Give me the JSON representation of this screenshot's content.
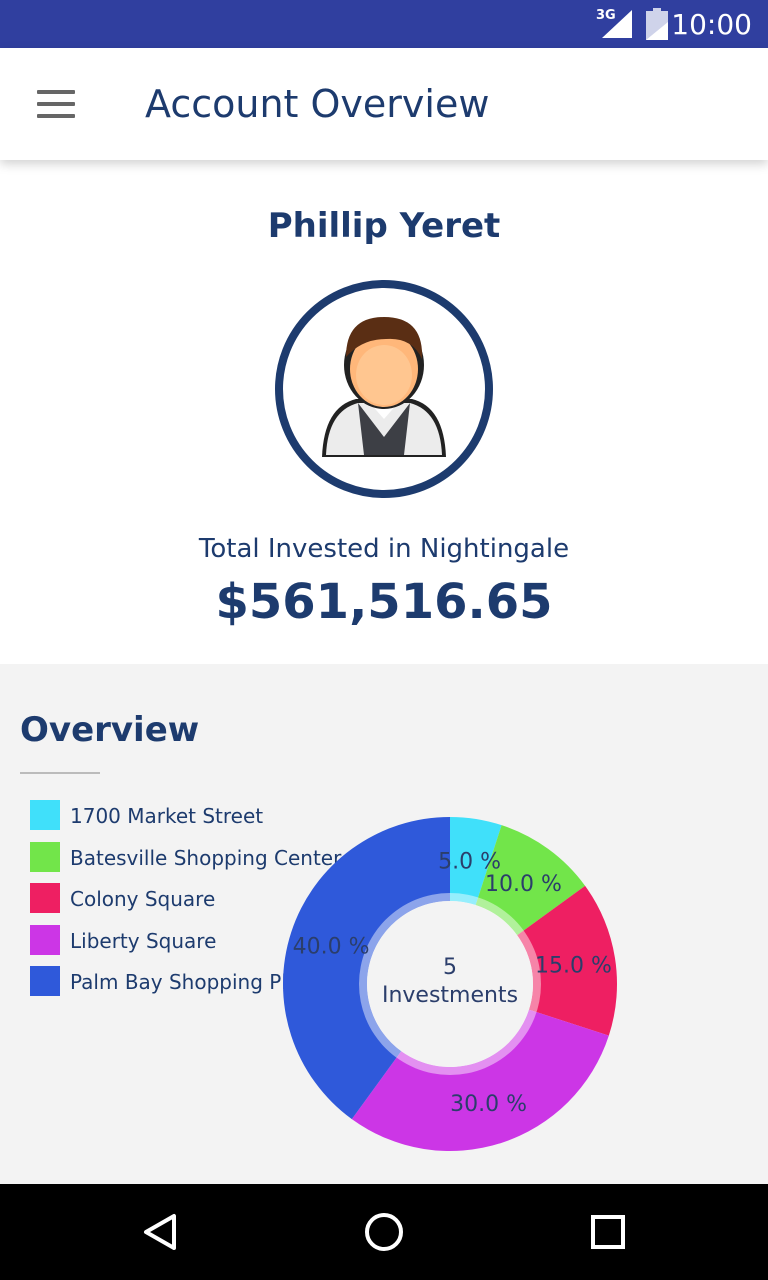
{
  "status_bar": {
    "network": "3G",
    "time": "10:00"
  },
  "app_bar": {
    "title": "Account Overview",
    "menu_icon": "hamburger-menu-icon"
  },
  "profile": {
    "name": "Phillip Yeret",
    "avatar_icon": "user-avatar-icon",
    "total_label": "Total Invested in Nightingale",
    "total_value": "$561,516.65"
  },
  "overview": {
    "title": "Overview"
  },
  "chart_data": {
    "type": "pie",
    "donut": true,
    "center_count": "5",
    "center_label": "Investments",
    "categories": [
      "1700 Market Street",
      "Batesville Shopping Center",
      "Colony Square",
      "Liberty Square",
      "Palm Bay Shopping Plaza"
    ],
    "values": [
      5.0,
      10.0,
      15.0,
      30.0,
      40.0
    ],
    "labels": [
      "5.0 %",
      "10.0 %",
      "15.0 %",
      "30.0 %",
      "40.0 %"
    ],
    "colors": [
      "#40e0fa",
      "#72e54a",
      "#ee1f62",
      "#cc36e6",
      "#2f59da"
    ],
    "legend_position": "left"
  },
  "nav_bar": {
    "back_icon": "back-triangle-icon",
    "home_icon": "home-circle-icon",
    "recents_icon": "recents-square-icon"
  }
}
